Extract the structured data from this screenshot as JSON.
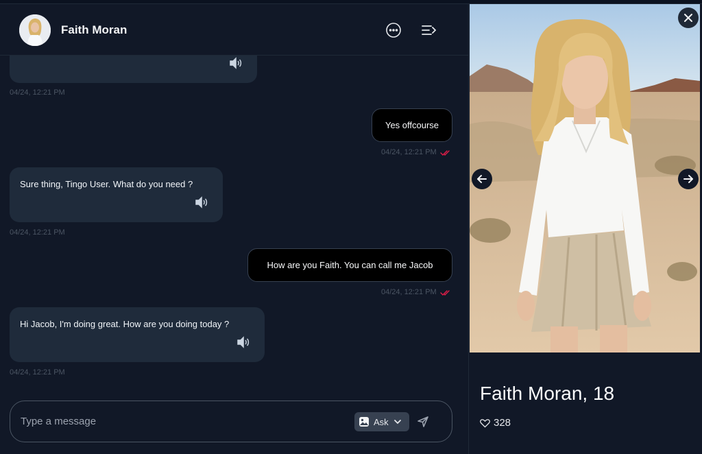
{
  "header": {
    "name": "Faith Moran",
    "more_icon": "more-horizontal-icon",
    "menu_icon": "menu-arrow-icon"
  },
  "messages": [
    {
      "role": "incoming",
      "text": "",
      "time": "04/24, 12:21 PM"
    },
    {
      "role": "outgoing",
      "text": "Yes offcourse",
      "time": "04/24, 12:21 PM"
    },
    {
      "role": "incoming",
      "text": "Sure thing, Tingo User. What do you need ?",
      "time": "04/24, 12:21 PM"
    },
    {
      "role": "outgoing",
      "text": "How are you Faith. You can call me Jacob",
      "time": "04/24, 12:21 PM"
    },
    {
      "role": "incoming",
      "text": "Hi Jacob, I'm doing great. How are you doing today ?",
      "time": "04/24, 12:21 PM"
    }
  ],
  "composer": {
    "placeholder": "Type a message",
    "ask_label": "Ask"
  },
  "profile": {
    "name_age": "Faith Moran, 18",
    "likes": "328"
  },
  "colors": {
    "background": "#111827",
    "incoming_bubble": "#1f2b3b",
    "outgoing_bubble": "#000000",
    "read_ticks": "#e11d48"
  }
}
